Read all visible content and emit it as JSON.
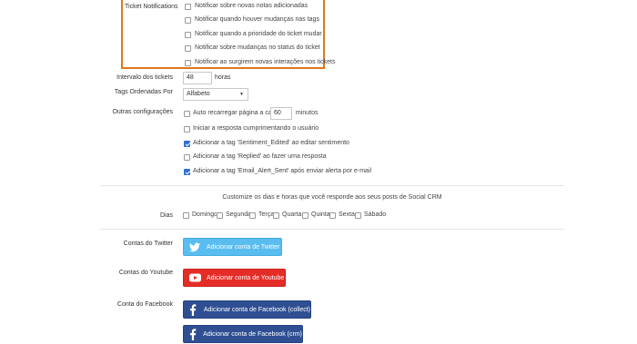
{
  "ticket_notifications": {
    "label": "Ticket Notifications",
    "options": [
      {
        "label": "Notificar sobre novas notas adicionadas",
        "checked": false
      },
      {
        "label": "Notificar quando houver mudanças nas tags",
        "checked": false
      },
      {
        "label": "Notificar quando a prioridade do ticket mudar",
        "checked": false
      },
      {
        "label": "Notificar sobre mudanças no status do ticket",
        "checked": false
      },
      {
        "label": "Notificar ao surgirem novas interações nos tickets",
        "checked": false
      }
    ]
  },
  "interval": {
    "label": "Intervalo dos tickets",
    "value": "48",
    "unit": "horas"
  },
  "tags_order": {
    "label": "Tags Ordenadas Por",
    "selected": "Alfabeto"
  },
  "other_settings": {
    "label": "Outras configurações",
    "auto_reload": {
      "label": "Auto recarregar página a cada",
      "value": "60",
      "unit": "minutos",
      "checked": false
    },
    "options": [
      {
        "label": "Iniciar a resposta cumprimentando o usuário",
        "checked": false
      },
      {
        "label": "Adicionar a tag 'Sentiment_Edited' ao editar sentimento",
        "checked": true
      },
      {
        "label": "Adicionar a tag 'Replied' ao fazer uma resposta",
        "checked": false
      },
      {
        "label": "Adicionar a tag 'Email_Alert_Sent' após enviar alerta por e-mail",
        "checked": true
      }
    ]
  },
  "schedule": {
    "description": "Customize os dias e horas que você responde aos seus posts de Social CRM",
    "days_label": "Dias",
    "days": [
      {
        "label": "Domingo",
        "checked": false
      },
      {
        "label": "Segunda",
        "checked": false
      },
      {
        "label": "Terça",
        "checked": false
      },
      {
        "label": "Quarta",
        "checked": false
      },
      {
        "label": "Quinta",
        "checked": false
      },
      {
        "label": "Sexta",
        "checked": false
      },
      {
        "label": "Sábado",
        "checked": false
      }
    ]
  },
  "accounts": {
    "twitter": {
      "label": "Contas do Twitter",
      "button": "Adicionar conta de Twitter"
    },
    "youtube": {
      "label": "Contas do Youtube",
      "button": "Adicionar conta de Youtube"
    },
    "facebook": {
      "label": "Conta do Facebook",
      "buttons": [
        "Adicionar conta de Facebook (collect)",
        "Adicionar conta de Facebook (crm)"
      ]
    }
  },
  "colors": {
    "highlight": "#e07818",
    "twitter": "#59bdf0",
    "youtube": "#e52d27",
    "facebook": "#2f4f92",
    "checkbox_checked": "#2f6fd6"
  },
  "icons": {
    "twitter": "twitter-icon",
    "youtube": "youtube-icon",
    "facebook": "facebook-icon",
    "select_caret": "chevron-down-icon"
  }
}
